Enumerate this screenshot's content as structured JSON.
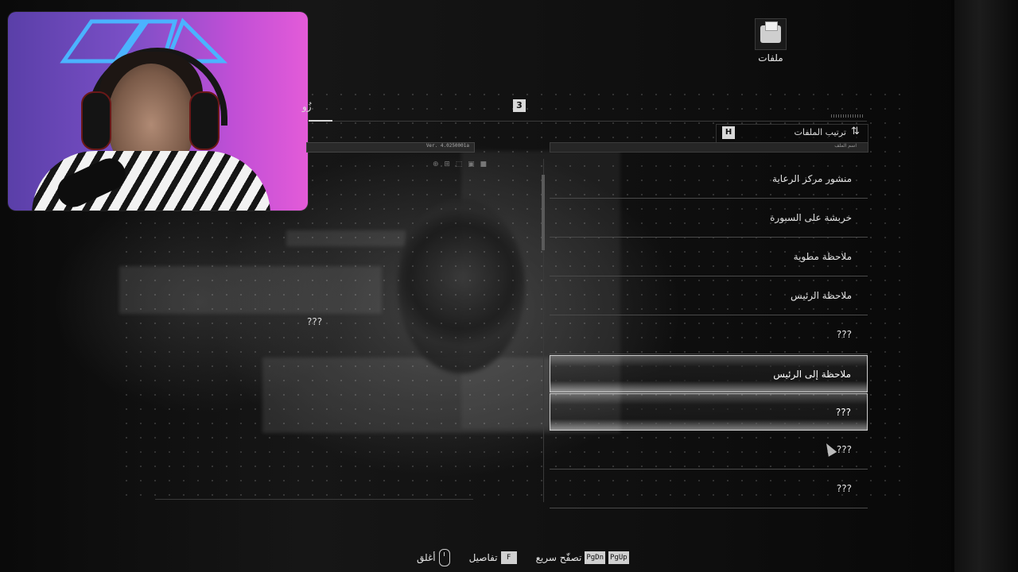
{
  "hud": {
    "files_label": "ملفات",
    "tab_partial": "زُو",
    "tab_count": "3",
    "sort_key": "H",
    "sort_label": "ترتيب الملفات",
    "version": "Ver. 4.0250001a",
    "list_header": "اسم الملف",
    "detail_text": "???"
  },
  "icons": {
    "files": "folder-icon",
    "sort": "sort-icon",
    "mouse": "mouse-icon"
  },
  "files": [
    "منشور مركز الرعاية",
    "خربشة على السبورة",
    "ملاحظة مطوية",
    "ملاحظة الرئيس",
    "???",
    "ملاحظة إلى الرئيس",
    "???",
    "???",
    "???"
  ],
  "selected_indices": [
    5,
    6
  ],
  "controls": {
    "pgup": "PgUp",
    "pgdn": "PgDn",
    "quick_browse": "تصفّح سريع",
    "f_key": "F",
    "details": "تفاصيل",
    "close": "أغلق"
  }
}
